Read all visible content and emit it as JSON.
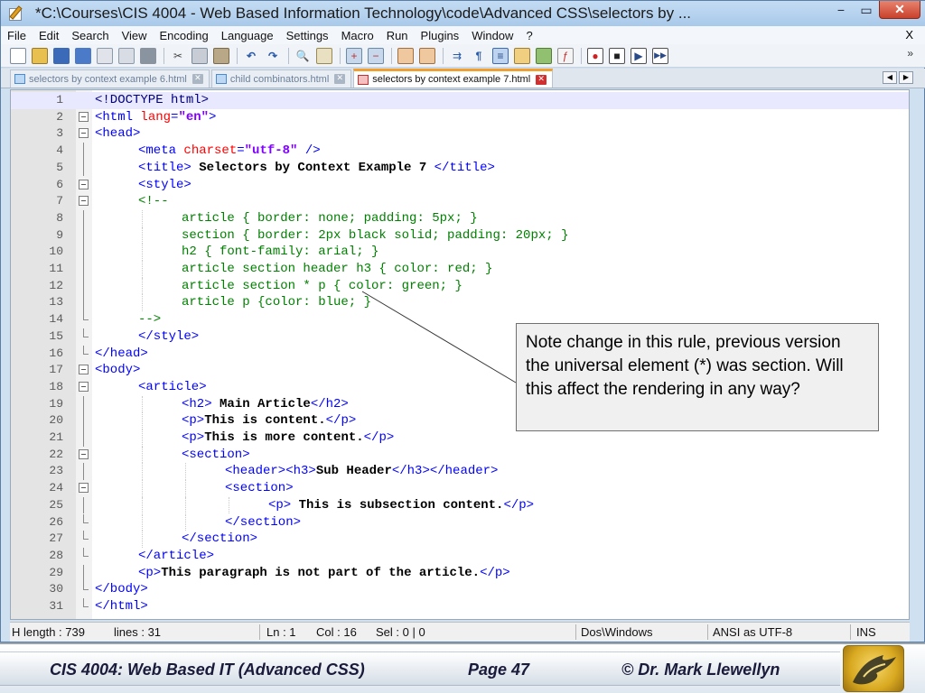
{
  "window": {
    "title": "*C:\\Courses\\CIS 4004 - Web Based Information Technology\\code\\Advanced CSS\\selectors by ...",
    "minimize_glyph": "−",
    "maximize_glyph": "▭",
    "close_glyph": "✕"
  },
  "menu": {
    "items": [
      "File",
      "Edit",
      "Search",
      "View",
      "Encoding",
      "Language",
      "Settings",
      "Macro",
      "Run",
      "Plugins",
      "Window",
      "?"
    ],
    "close": "X"
  },
  "toolbar": {
    "icons": [
      "new-file-icon",
      "open-file-icon",
      "save-icon",
      "save-all-icon",
      "close-file-icon",
      "close-all-icon",
      "print-icon",
      "cut-icon",
      "copy-icon",
      "paste-icon",
      "undo-icon",
      "redo-icon",
      "find-icon",
      "replace-icon",
      "zoom-in-icon",
      "zoom-out-icon",
      "sync-vertical-icon",
      "sync-horizontal-icon",
      "word-wrap-icon",
      "show-all-chars-icon",
      "indent-guide-icon",
      "user-lang-icon",
      "doc-map-icon",
      "function-list-icon",
      "record-macro-icon",
      "stop-macro-icon",
      "play-macro-icon",
      "run-macro-multiple-icon"
    ],
    "more": "»"
  },
  "tabs": [
    {
      "label": "selectors by context example 6.html",
      "active": false
    },
    {
      "label": "child combinators.html",
      "active": false
    },
    {
      "label": "selectors by context example 7.html",
      "active": true
    }
  ],
  "code_lines": [
    "1",
    "2",
    "3",
    "4",
    "5",
    "6",
    "7",
    "8",
    "9",
    "10",
    "11",
    "12",
    "13",
    "14",
    "15",
    "16",
    "17",
    "18",
    "19",
    "20",
    "21",
    "22",
    "23",
    "24",
    "25",
    "26",
    "27",
    "28",
    "29",
    "30",
    "31"
  ],
  "code": {
    "l1": "<!DOCTYPE html>",
    "l2_open": "<html ",
    "l2_attr": "lang",
    "l2_eq": "=",
    "l2_val": "\"en\"",
    "l2_close": ">",
    "l3": "<head>",
    "l4_open": "<meta ",
    "l4_attr": "charset",
    "l4_eq": "=",
    "l4_val": "\"utf-8\"",
    "l4_close": " />",
    "l5_open": "<title>",
    "l5_text": " Selectors by Context Example 7 ",
    "l5_close": "</title>",
    "l6": "<style>",
    "l7": "<!--",
    "l8": "article { border: none; padding: 5px; }",
    "l9": "section { border: 2px black solid; padding: 20px; }",
    "l10": "h2 { font-family: arial; }",
    "l11": "article section header h3 { color: red; }",
    "l12": "article section * p { color: green; }",
    "l13": "article p {color: blue; }",
    "l14": "-->",
    "l15": "</style>",
    "l16": "</head>",
    "l17": "<body>",
    "l18": "<article>",
    "l19_open": "<h2>",
    "l19_text": " Main Article",
    "l19_close": "</h2>",
    "l20_open": "<p>",
    "l20_text": "This is content.",
    "l20_close": "</p>",
    "l21_open": "<p>",
    "l21_text": "This is more content.",
    "l21_close": "</p>",
    "l22": "<section>",
    "l23_open": "<header><h3>",
    "l23_text": "Sub Header",
    "l23_close": "</h3></header>",
    "l24": "<section>",
    "l25_open": "<p>",
    "l25_text": " This is subsection content.",
    "l25_close": "</p>",
    "l26": "</section>",
    "l27": "</section>",
    "l28": "</article>",
    "l29_open": "<p>",
    "l29_text": "This paragraph is not part of the article.",
    "l29_close": "</p>",
    "l30": "</body>",
    "l31": "</html>"
  },
  "callout": {
    "text": "Note change in this rule, previous version the universal element (*) was section.  Will this affect the rendering in any way?"
  },
  "status": {
    "length": "H length : 739",
    "lines": "lines : 31",
    "ln": "Ln : 1",
    "col": "Col : 16",
    "sel": "Sel : 0 | 0",
    "eol": "Dos\\Windows",
    "encoding": "ANSI as UTF-8",
    "mode": "INS"
  },
  "footer": {
    "course": "CIS 4004: Web Based IT (Advanced CSS)",
    "page": "Page 47",
    "author": "© Dr. Mark Llewellyn"
  },
  "colors": {
    "tag": "#0000ff",
    "attribute": "#ff0000",
    "value": "#8000ff",
    "css_comment": "#008000",
    "active_tab_accent": "#f0a030"
  }
}
